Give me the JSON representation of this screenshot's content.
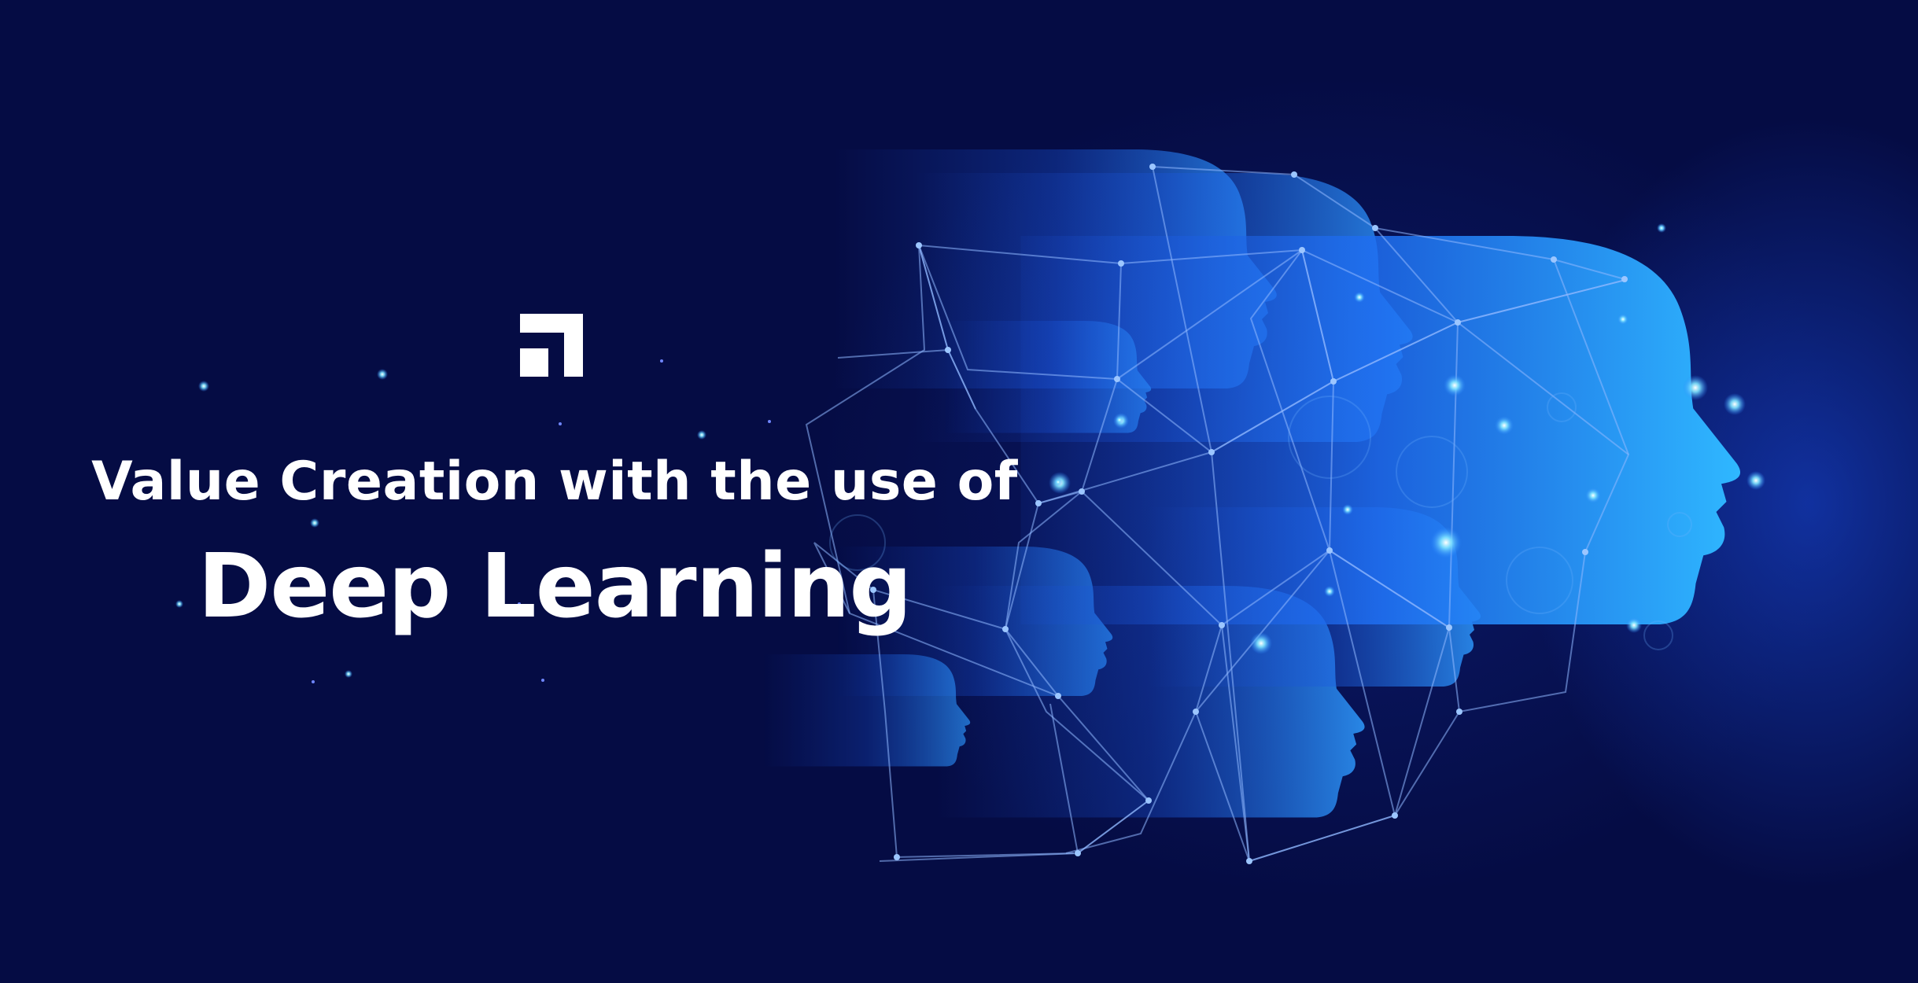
{
  "banner": {
    "headline_line1": "Value Creation with the use of",
    "headline_line2": "Deep Learning"
  },
  "brand": {
    "logo_icon": "square-arrow-logo-icon"
  },
  "illustration": {
    "subject": "ai-heads-network-icon"
  },
  "colors": {
    "background": "#050c44",
    "head_highlight": "#3fd2ff",
    "head_base": "#1f6ff2",
    "network_line": "#8fb8ff",
    "text": "#ffffff"
  }
}
